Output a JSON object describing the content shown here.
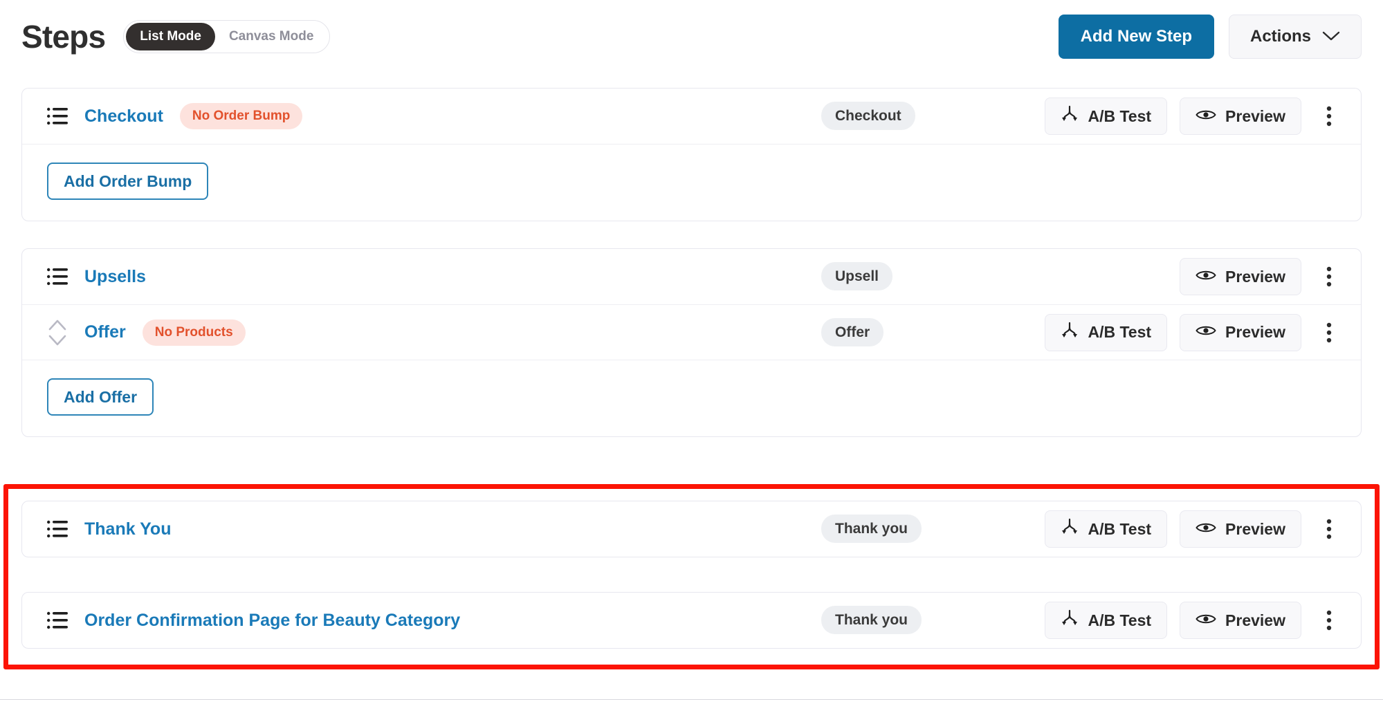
{
  "header": {
    "title": "Steps",
    "mode_toggle": {
      "options": [
        {
          "label": "List Mode",
          "active": true
        },
        {
          "label": "Canvas Mode",
          "active": false
        }
      ]
    },
    "add_new_step_label": "Add New Step",
    "actions_label": "Actions",
    "actions_chevron": "chevron-down-icon",
    "primary_color": "#0d6ea3"
  },
  "labels": {
    "ab_test": "A/B Test",
    "preview": "Preview",
    "kebab": "more-options-icon",
    "ab_test_icon": "ab-split-icon",
    "preview_icon": "eye-icon",
    "list_icon": "list-icon",
    "sort_icon": "sort-updown-icon"
  },
  "colors": {
    "link": "#1a7ab8",
    "warn_badge_bg": "#fde2dd",
    "warn_badge_text": "#e2512c",
    "type_badge_bg": "#edeff2",
    "annotation_red": "#fc1405"
  },
  "cards": [
    {
      "id": "checkout-card",
      "rows": [
        {
          "title": "Checkout",
          "warn_badge": "No Order Bump",
          "type_badge": "Checkout",
          "has_ab_test": true,
          "has_preview": true,
          "has_kebab": true,
          "leading_icon": "list-icon"
        }
      ],
      "footer_button": "Add Order Bump"
    },
    {
      "id": "upsells-card",
      "rows": [
        {
          "title": "Upsells",
          "warn_badge": null,
          "type_badge": "Upsell",
          "has_ab_test": false,
          "has_preview": true,
          "has_kebab": true,
          "leading_icon": "list-icon"
        },
        {
          "title": "Offer",
          "warn_badge": "No Products",
          "type_badge": "Offer",
          "has_ab_test": true,
          "has_preview": true,
          "has_kebab": true,
          "leading_icon": "sort-updown-icon"
        }
      ],
      "footer_button": "Add Offer"
    },
    {
      "id": "thank-you-card",
      "rows": [
        {
          "title": "Thank You",
          "warn_badge": null,
          "type_badge": "Thank you",
          "has_ab_test": true,
          "has_preview": true,
          "has_kebab": true,
          "leading_icon": "list-icon"
        }
      ],
      "footer_button": null
    },
    {
      "id": "order-confirmation-card",
      "rows": [
        {
          "title": "Order Confirmation Page for Beauty Category",
          "warn_badge": null,
          "type_badge": "Thank you",
          "has_ab_test": true,
          "has_preview": true,
          "has_kebab": true,
          "leading_icon": "list-icon"
        }
      ],
      "footer_button": null
    }
  ],
  "annotation": {
    "type": "red-highlight-rectangle",
    "covers": [
      "thank-you-card",
      "order-confirmation-card"
    ]
  }
}
